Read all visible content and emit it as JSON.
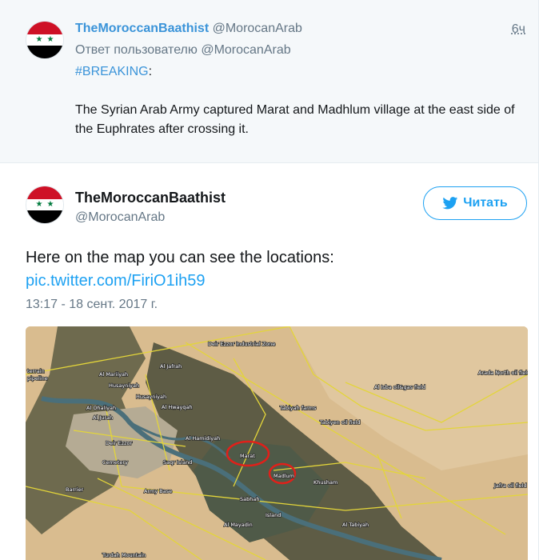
{
  "parent_tweet": {
    "display_name": "TheMoroccanBaathist",
    "handle": "@MorocanArab",
    "time": "6ч",
    "reply_to": "Ответ пользователю @MorocanArab",
    "hashtag": "#BREAKING",
    "hashtag_suffix": ":",
    "body": "The Syrian Arab Army captured Marat and Madhlum village at the east side of the Euphrates after crossing it."
  },
  "main_tweet": {
    "display_name": "TheMoroccanBaathist",
    "handle": "@MorocanArab",
    "follow_label": "Читать",
    "text": "Here on the map you can see the locations:",
    "link": "pic.twitter.com/FiriO1ih59",
    "date": "13:17 - 18 сент. 2017 г."
  },
  "avatar_icon": "syria-flag-icon",
  "follow_icon": "twitter-bird-icon",
  "colors": {
    "link_blue": "#1da1f2",
    "name_blue": "#3b94d9",
    "muted_gray": "#657786",
    "flag_red": "#ce1126",
    "flag_green": "#007a3d",
    "highlight_circle": "#e0201a"
  },
  "map": {
    "labels": {
      "industrial": "Deir Ezzor Industrial Zone",
      "terrain": "terrain",
      "pipeline": "pipeline",
      "mariiyah": "Al Mariiyah",
      "jafrah": "Al Jafrah",
      "husayniyah": "Husayniyah",
      "husayniyah2": "Husayniyah",
      "hwayqah": "Al Hwayqah",
      "ohaliyah": "Al Ohaliyah",
      "jurah": "Al Jurah",
      "deir_ezzor": "Deir Ezzor",
      "cemetery": "Cemetery",
      "saqr_island": "Saqr Island",
      "al_hamidiyah": "Al Hamidiyah",
      "barrier": "Barrier",
      "army_base": "Army Base",
      "marat": "Marat",
      "madlum": "Madlum",
      "sabhah": "Sabhah",
      "khusham": "Khusham",
      "island": "Island",
      "tabiyah": "Al Tabiyah",
      "mayadin": "Al Mayadin",
      "turdah": "Turdah Mountain",
      "tabiyah_farms": "Tabiyah farms",
      "tabiyen_field": "Tabiyen oil field",
      "isba_field": "Al Isba oil&gas field",
      "jafra_field": "Jafra oil field",
      "arada": "Arada North oil field"
    }
  }
}
